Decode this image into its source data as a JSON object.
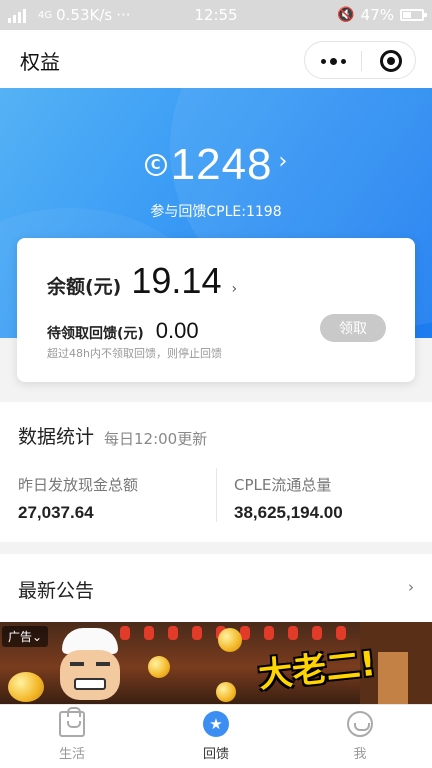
{
  "status_bar": {
    "network": "4G",
    "speed": "0.53K/s",
    "dots": "···",
    "time": "12:55",
    "battery": "47%",
    "battery_level": 0.47
  },
  "nav": {
    "title": "权益"
  },
  "points": {
    "coin_symbol": "C",
    "value": "1248",
    "arrow": "›",
    "subtitle": "参与回馈CPLE:1198"
  },
  "balance": {
    "label": "余额(元)",
    "value": "19.14",
    "arrow": "›",
    "pending_label": "待领取回馈(元)",
    "pending_value": "0.00",
    "note": "超过48h内不领取回馈，则停止回馈",
    "claim_button": "领取"
  },
  "stats": {
    "title": "数据统计",
    "update_note": "每日12:00更新",
    "items": [
      {
        "label": "昨日发放现金总额",
        "value": "27,037.64"
      },
      {
        "label": "CPLE流通总量",
        "value": "38,625,194.00"
      }
    ]
  },
  "announcements": {
    "title": "最新公告",
    "arrow": "›"
  },
  "banner": {
    "ad_tag": "广告⌄",
    "headline": "大老二!"
  },
  "tabs": [
    {
      "label": "生活",
      "icon": "bag-icon"
    },
    {
      "label": "回馈",
      "icon": "star-icon"
    },
    {
      "label": "我",
      "icon": "profile-icon"
    }
  ]
}
